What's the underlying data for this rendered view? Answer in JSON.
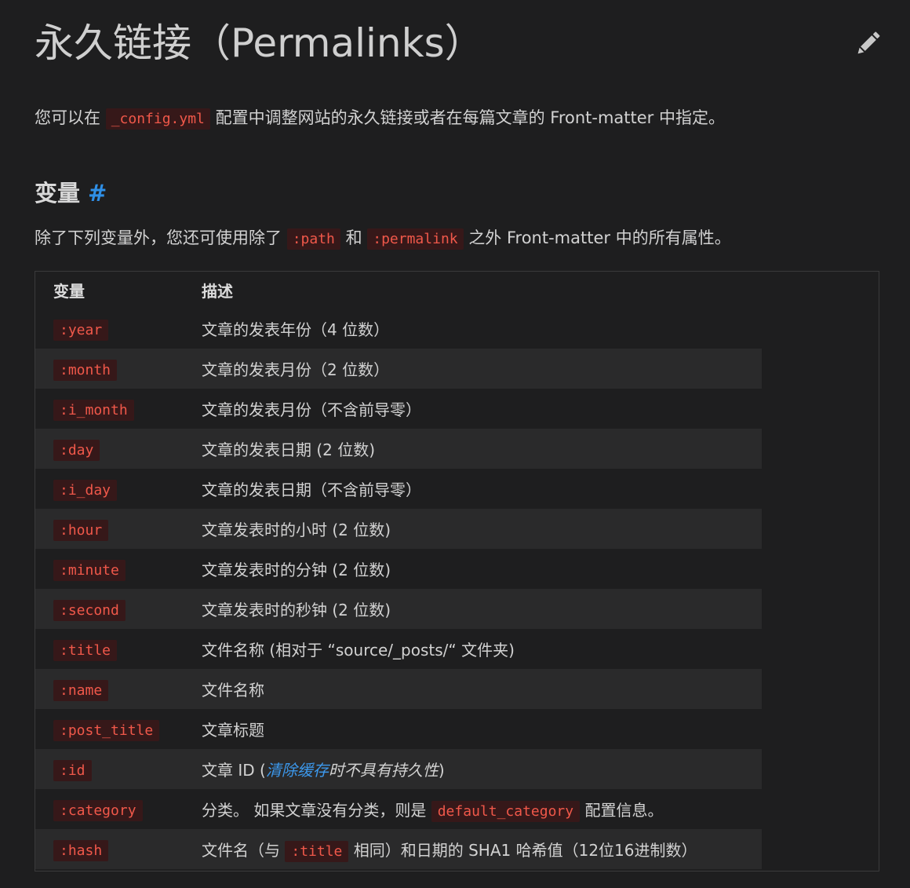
{
  "title": "永久链接（Permalinks）",
  "intro": {
    "before": "您可以在",
    "code": "_config.yml",
    "after": "配置中调整网站的永久链接或者在每篇文章的 Front-matter 中指定。"
  },
  "section": {
    "heading": "变量",
    "anchor": "#",
    "desc_before": "除了下列变量外，您还可使用除了",
    "code1": ":path",
    "desc_mid": "和",
    "code2": ":permalink",
    "desc_after": "之外 Front-matter 中的所有属性。"
  },
  "table": {
    "headers": [
      "变量",
      "描述"
    ],
    "rows": [
      {
        "var": ":year",
        "desc": "文章的发表年份（4 位数）"
      },
      {
        "var": ":month",
        "desc": "文章的发表月份（2 位数）"
      },
      {
        "var": ":i_month",
        "desc": "文章的发表月份（不含前导零）"
      },
      {
        "var": ":day",
        "desc": "文章的发表日期 (2 位数)"
      },
      {
        "var": ":i_day",
        "desc": "文章的发表日期（不含前导零）"
      },
      {
        "var": ":hour",
        "desc": "文章发表时的小时 (2 位数)"
      },
      {
        "var": ":minute",
        "desc": "文章发表时的分钟 (2 位数)"
      },
      {
        "var": ":second",
        "desc": "文章发表时的秒钟 (2 位数)"
      },
      {
        "var": ":title",
        "desc": "文件名称 (相对于 “source/_posts/“ 文件夹)"
      },
      {
        "var": ":name",
        "desc": "文件名称"
      },
      {
        "var": ":post_title",
        "desc": "文章标题"
      }
    ],
    "id_row": {
      "var": ":id",
      "before": "文章 ID (",
      "link": "清除缓存",
      "italic": "时不具有持久性",
      "after": ")"
    },
    "category_row": {
      "var": ":category",
      "before": "分类。 如果文章没有分类，则是",
      "code": "default_category",
      "after": "配置信息。"
    },
    "hash_row": {
      "var": ":hash",
      "before": "文件名（与",
      "code": ":title",
      "after": "相同）和日期的 SHA1 哈希值（12位16进制数）"
    }
  },
  "colors": {
    "background": "#1e1e1f",
    "code_text": "#f0584a",
    "code_bg": "#361819",
    "link": "#3c98ec",
    "anchor": "#2f8fe6"
  }
}
